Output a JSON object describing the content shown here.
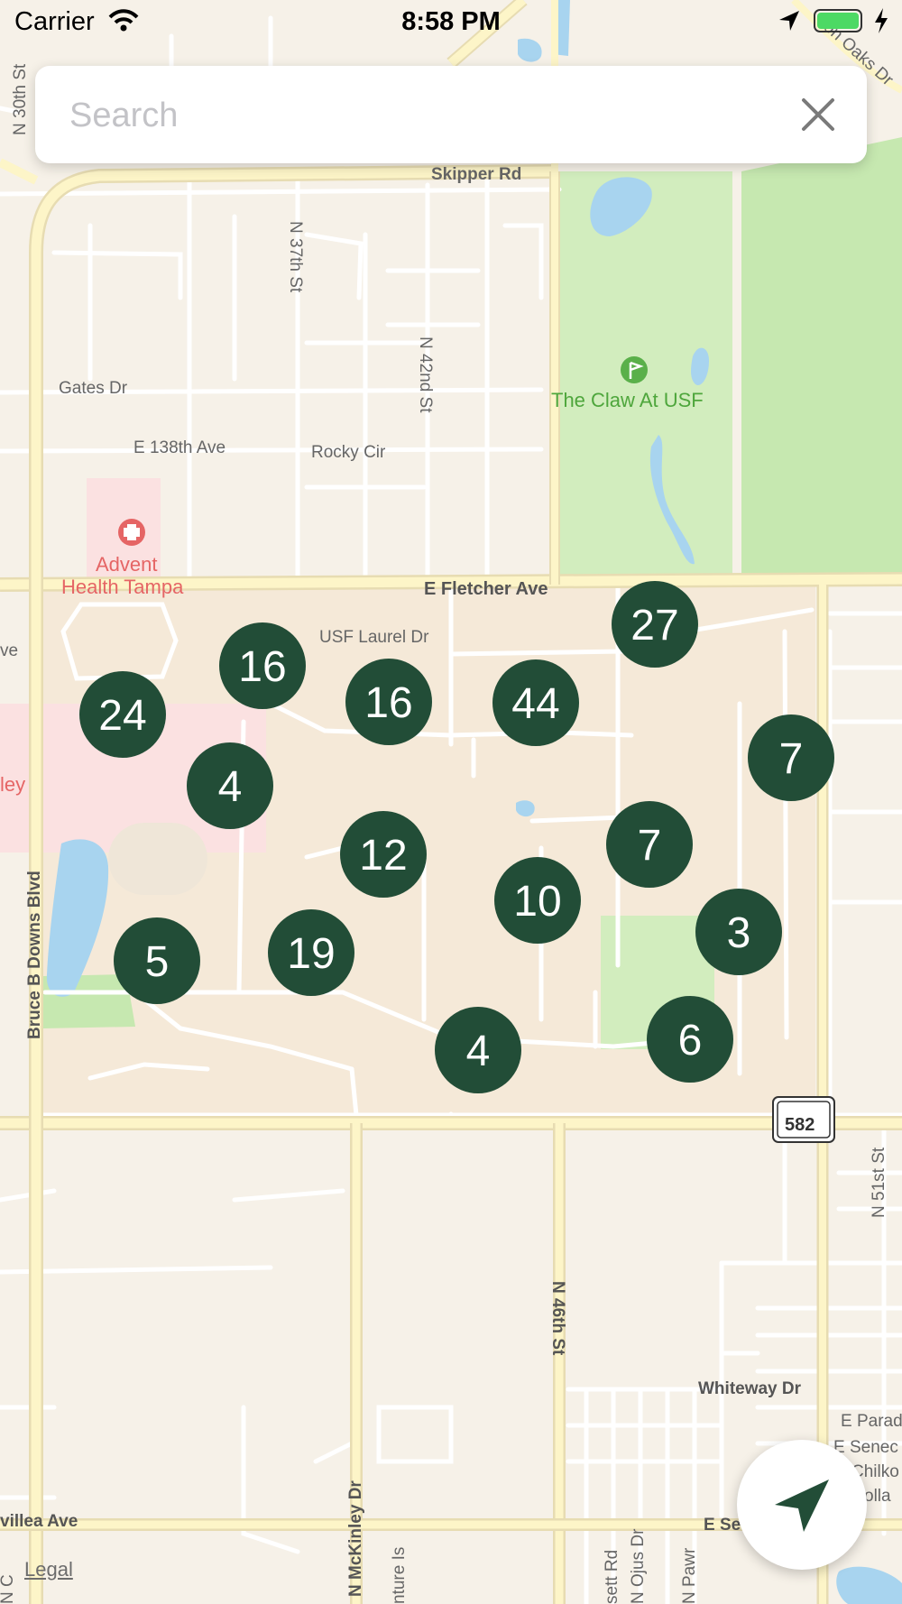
{
  "status_bar": {
    "carrier": "Carrier",
    "time": "8:58 PM"
  },
  "search": {
    "placeholder": "Search"
  },
  "map": {
    "labels": {
      "n30th": "N 30th St",
      "skipper": "Skipper Rd",
      "johnoaks": "Jon Oaks Dr",
      "n37th": "N 37th St",
      "gates": "Gates Dr",
      "n42nd": "N 42nd St",
      "claw": "The Claw At USF",
      "e138": "E 138th Ave",
      "rocky": "Rocky Cir",
      "advent1": "Advent",
      "advent2": "Health Tampa",
      "fletcher": "E Fletcher Ave",
      "laurel": "USF Laurel Dr",
      "ave_left": "ve",
      "ley": "ley",
      "bruce": "Bruce B Downs Blvd",
      "shield582": "582",
      "n46th": "N 46th St",
      "n51st": "N 51st St",
      "whiteway": "Whiteway Dr",
      "eparad": "E Parad",
      "eseneca": "E Senec",
      "chilko": "Chilko",
      "holla": "olla",
      "villea": "villea Ave",
      "ese": "E Se",
      "mckinley": "N McKinley Dr",
      "venture": "nture Is",
      "bassett": "sett Rd",
      "ojus": "N Ojus Dr",
      "npawr": "N Pawr",
      "nc": "N C"
    },
    "clusters": [
      "27",
      "16",
      "16",
      "44",
      "24",
      "7",
      "4",
      "12",
      "7",
      "10",
      "3",
      "5",
      "19",
      "4",
      "6"
    ],
    "legal_label": "Legal"
  },
  "colors": {
    "cluster_fill": "#224d37",
    "park": "#c6e8b0",
    "water": "#a8d4ef",
    "campus": "#f5e9d8",
    "road_major": "#fdf5c8",
    "hospital": "#fbe1e1"
  },
  "icons": {
    "signal": "wifi-icon",
    "location": "location-arrow-icon",
    "battery": "battery-icon",
    "charging": "bolt-icon",
    "clear": "close-icon",
    "locate": "navigation-arrow-icon",
    "golf": "golf-icon",
    "hospital": "hospital-icon"
  }
}
